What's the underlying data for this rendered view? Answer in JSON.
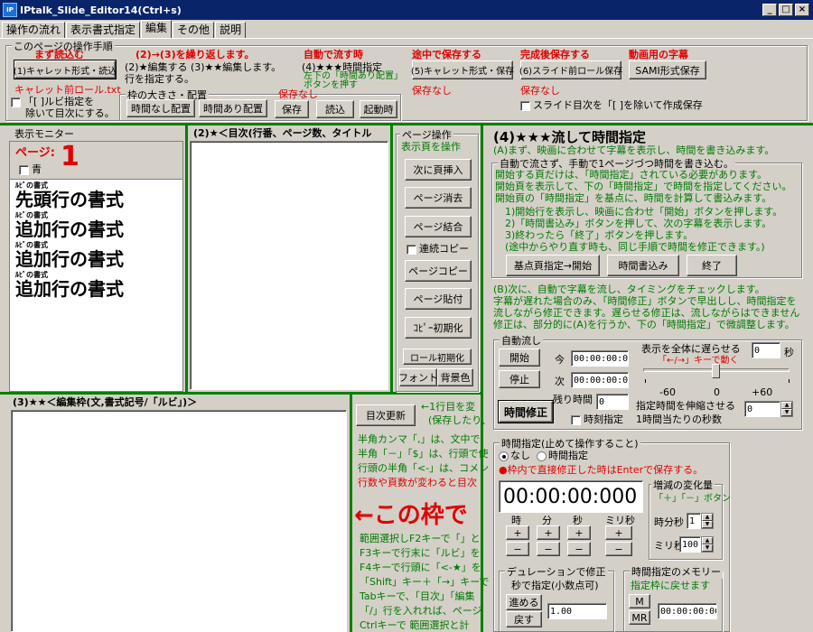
{
  "title": "IPtalk_Slide_Editor14(Ctrl+s)",
  "app_icon": "IP",
  "window_btns": {
    "min": "_",
    "max": "□",
    "close": "×"
  },
  "tabs": [
    "操作の流れ",
    "表示書式指定",
    "編集",
    "その他",
    "説明"
  ],
  "proc": {
    "group_title": "このページの操作手順",
    "step1_red": "まず読込む",
    "step1_btn": "(1)キャレット形式・読込",
    "step23_red": "(2)→(3)を繰り返します。",
    "step23_text": "(2)★編集する (3)★★編集します。",
    "step23_text2": "行を指定する。",
    "auto_red": "自動で流す時",
    "auto_text": "(4)★★★時間指定",
    "auto_green1": "左下の「時間あり配置」",
    "auto_green2": "ボタンを押す",
    "mid_red": "途中で保存する",
    "mid_btn": "(5)キャレット形式・保存",
    "mid_note": "保存なし",
    "done_red": "完成後保存する",
    "done_btn": "(6)スライド前ロール保存",
    "done_note": "保存なし",
    "video_red": "動画用の字幕",
    "video_btn": "SAMI形式保存",
    "caret_file": "キャレット前ロール.txt",
    "ruby_chk1": "「[ ]ルビ指定を",
    "ruby_chk2": "除いて目次にする。",
    "frame_title": "枠の大きさ・配置",
    "frame_btns": [
      "時間なし配置",
      "時間あり配置",
      "保存",
      "読込",
      "起動時"
    ],
    "frame_note": "保存なし",
    "slide_chk": "スライド目次を「[ ]を除いて作成保存"
  },
  "monitor": {
    "title": "表示モニター",
    "page_label": "ページ:",
    "page_num": "1",
    "blue_label": "青",
    "lines": [
      {
        "ruby": "ﾙﾋﾞの書式",
        "text": "先頭行の書式"
      },
      {
        "ruby": "ﾙﾋﾞの書式",
        "text": "追加行の書式"
      },
      {
        "ruby": "ﾙﾋﾞの書式",
        "text": "追加行の書式"
      },
      {
        "ruby": "ﾙﾋﾞの書式",
        "text": "追加行の書式"
      }
    ]
  },
  "toc": {
    "title": "(2)★＜目次(行番、ページ数、タイトル"
  },
  "pageop": {
    "title": "ページ操作",
    "subtitle": "表示頁を操作",
    "btns": [
      "次に頁挿入",
      "ページ消去",
      "ページ結合"
    ],
    "chk": "連続コピー",
    "btns2": [
      "ページコピー",
      "ページ貼付",
      "ｺﾋﾟｰ初期化",
      "ロール初期化"
    ],
    "font_btn": "フォント",
    "bg_btn": "背景色"
  },
  "edit": {
    "title": "(3)★★＜編集枠(文,書式記号/「ルビ」)＞"
  },
  "help": {
    "btn": "目次更新",
    "t1": "←1行目を変",
    "t2": "(保存したり、",
    "lines": [
      "半角カンマ「,」は、文中で",
      "半角「－」「$」は、行頭で使",
      "行頭の半角「<-」は、コメン"
    ],
    "redline": "行数や頁数が変わると目次",
    "big": "←この枠で",
    "lines2": [
      "範囲選択しF2キーで「」と",
      "F3キーで行末に「ルビ」を",
      "F4キーで行頭に「<-★」を",
      "「Shift」キー＋「→」キーで",
      "Tabキーで、「目次」「編集",
      "「/」行を入れれば、ページ",
      "Ctrlキーで 範囲選択と計"
    ]
  },
  "timing": {
    "title": "(4)★★★流して時間指定",
    "sub": "(A)まず、映画に合わせて字幕を表示し、時間を書き込みます。",
    "manual_title": "自動で流さず、手動で1ページづつ時間を書き込む。",
    "manual_lines": [
      "開始する頁だけは、「時間指定」されている必要があります。",
      "開始頁を表示して、下の「時間指定」で時間を指定してください。",
      "開始頁の「時間指定」を基点に、時間を計算して書込みます。",
      "　1)開始行を表示し、映画に合わせ「開始」ボタンを押します。",
      "　2)「時間書込み」ボタンを押して、次の字幕を表示します。",
      "　3)終わったら「終了」ボタンを押します。",
      "　(途中からやり直す時も、同じ手順で時間を修正できます。)"
    ],
    "manual_btns": [
      "基点頁指定→開始",
      "時間書込み",
      "終了"
    ],
    "b_lines": [
      "(B)次に、自動で字幕を流し、タイミングをチェックします。",
      "字幕が遅れた場合のみ、「時間修正」ボタンで早出しし、時間指定を",
      "流しながら修正できます。遅らせる修正は、流しながらはできません",
      "修正は、部分的に(A)を行うか、下の「時間指定」で微調整します。"
    ],
    "auto_title": "自動流し",
    "start_btn": "開始",
    "stop_btn": "停止",
    "now_label": "今",
    "next_label": "次",
    "now_val": "00:00:00:000",
    "next_val": "00:00:00:000",
    "remain_label": "残り時間",
    "remain_val": "0",
    "fix_btn": "時間修正",
    "time_chk": "時刻指定",
    "delay_label": "表示を全体に遅らせる",
    "delay_val": "0",
    "sec_unit": "秒",
    "arrow_note": "「←/→」キーで動く",
    "ticks": [
      "-60",
      "0",
      "+60"
    ],
    "stretch1": "指定時間を伸縮させる",
    "stretch2": "1時間当たりの秒数",
    "stretch_val": "0",
    "spec_title": "時間指定(止めて操作すること)",
    "radio_none": "なし",
    "radio_spec": "時間指定",
    "enter_note": "●枠内で直接修正した時はEnterで保存する。",
    "big_time": "00:00:00:000",
    "units": [
      "時",
      "分",
      "秒",
      "ミリ秒"
    ],
    "inc_title": "増減の変化量",
    "inc_sub": "「＋」「－」ボタン",
    "hm_label": "時分秒",
    "hm_val": "1",
    "ms_label": "ミリ秒",
    "ms_val": "100",
    "dur_title": "デュレーションで修正",
    "dur_sub": "秒で指定(小数点可)",
    "adv_btn": "進める",
    "back_btn": "戻す",
    "dur_val": "1.00",
    "mem_title": "時間指定のメモリー",
    "mem_sub": "指定枠に戻せます",
    "m_btn": "M",
    "mr_btn": "MR",
    "mem_val": "00:00:00:000"
  }
}
